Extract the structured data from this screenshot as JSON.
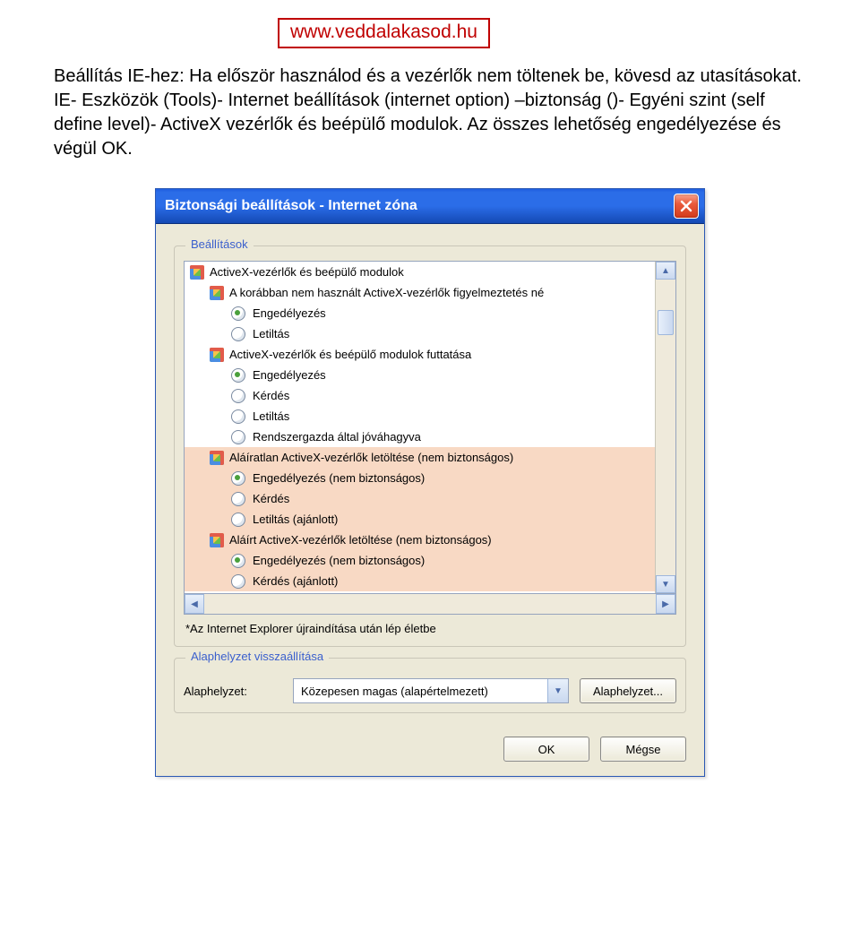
{
  "url_box": "www.veddalakasod.hu",
  "intro": "Beállítás IE-hez: Ha először használod és a vezérlők nem töltenek be, kövesd az utasításokat. IE- Eszközök (Tools)- Internet beállítások (internet option) –biztonság ()- Egyéni szint (self define level)- ActiveX vezérlők és beépülő modulok.  Az összes lehetőség engedélyezése és végül OK.",
  "dialog": {
    "title": "Biztonsági beállítások - Internet zóna",
    "group_settings": "Beállítások",
    "items": [
      {
        "type": "header",
        "icon": true,
        "label": "ActiveX-vezérlők és beépülő modulok",
        "indent": 0
      },
      {
        "type": "header",
        "icon": true,
        "label": "A korábban nem használt ActiveX-vezérlők figyelmeztetés né",
        "indent": 1
      },
      {
        "type": "radio",
        "checked": true,
        "label": "Engedélyezés",
        "indent": 2
      },
      {
        "type": "radio",
        "checked": false,
        "label": "Letiltás",
        "indent": 2
      },
      {
        "type": "header",
        "icon": true,
        "label": "ActiveX-vezérlők és beépülő modulok futtatása",
        "indent": 1
      },
      {
        "type": "radio",
        "checked": true,
        "label": "Engedélyezés",
        "indent": 2
      },
      {
        "type": "radio",
        "checked": false,
        "label": "Kérdés",
        "indent": 2
      },
      {
        "type": "radio",
        "checked": false,
        "label": "Letiltás",
        "indent": 2
      },
      {
        "type": "radio",
        "checked": false,
        "label": "Rendszergazda által jóváhagyva",
        "indent": 2
      },
      {
        "type": "header",
        "icon": true,
        "label": "Aláíratlan ActiveX-vezérlők letöltése (nem biztonságos)",
        "indent": 1,
        "unsafe": true
      },
      {
        "type": "radio",
        "checked": true,
        "label": "Engedélyezés (nem biztonságos)",
        "indent": 2,
        "unsafe": true
      },
      {
        "type": "radio",
        "checked": false,
        "label": "Kérdés",
        "indent": 2,
        "unsafe": true
      },
      {
        "type": "radio",
        "checked": false,
        "label": "Letiltás (ajánlott)",
        "indent": 2,
        "unsafe": true
      },
      {
        "type": "header",
        "icon": true,
        "label": "Aláírt ActiveX-vezérlők letöltése (nem biztonságos)",
        "indent": 1,
        "unsafe": true
      },
      {
        "type": "radio",
        "checked": true,
        "label": "Engedélyezés (nem biztonságos)",
        "indent": 2,
        "unsafe": true
      },
      {
        "type": "radio",
        "checked": false,
        "label": "Kérdés (ajánlott)",
        "indent": 2,
        "unsafe": true
      }
    ],
    "note": "*Az Internet Explorer újraindítása után lép életbe",
    "group_reset": "Alaphelyzet visszaállítása",
    "reset_label": "Alaphelyzet:",
    "combo_value": "Közepesen magas (alapértelmezett)",
    "reset_button": "Alaphelyzet...",
    "ok": "OK",
    "cancel": "Mégse"
  }
}
